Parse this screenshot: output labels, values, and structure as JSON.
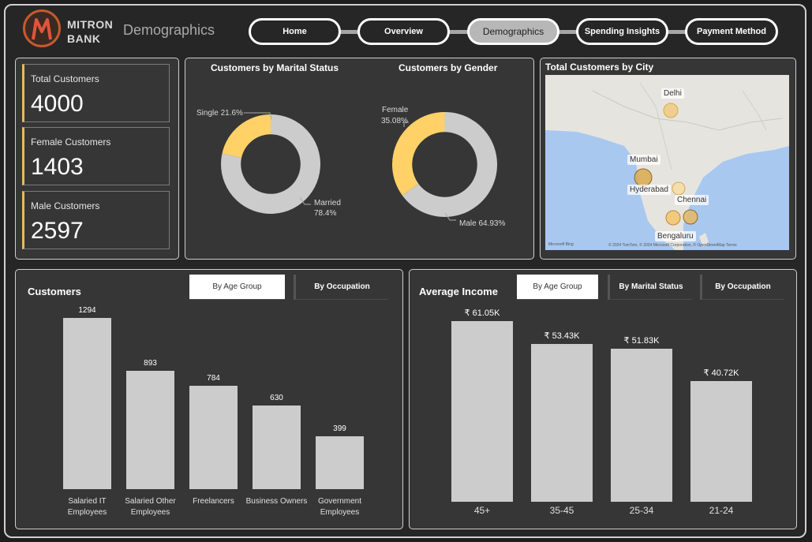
{
  "brand": {
    "line1": "MITRON",
    "line2": "BANK",
    "logo_letter": "M"
  },
  "page_title": "Demographics",
  "nav": [
    {
      "label": "Home",
      "active": false
    },
    {
      "label": "Overview",
      "active": false
    },
    {
      "label": "Demographics",
      "active": true
    },
    {
      "label": "Spending Insights",
      "active": false
    },
    {
      "label": "Payment Method",
      "active": false
    }
  ],
  "kpis": [
    {
      "label": "Total Customers",
      "value": "4000"
    },
    {
      "label": "Female Customers",
      "value": "1403"
    },
    {
      "label": "Male Customers",
      "value": "2597"
    }
  ],
  "marital": {
    "title": "Customers by Marital Status",
    "single_label": "Single 21.6%",
    "married_label": "Married",
    "married_pct": "78.4%"
  },
  "gender": {
    "title": "Customers by Gender",
    "female_label": "Female",
    "female_pct": "35.08%",
    "male_label": "Male 64.93%"
  },
  "city": {
    "title": "Total Customers by City",
    "cities": [
      "Delhi",
      "Mumbai",
      "Hyderabad",
      "Chennai",
      "Bengaluru"
    ],
    "foot_brand": "Microsoft Bing",
    "foot_copy": "© 2024 TomTom, © 2024 Microsoft Corporation, © OpenStreetMap  Terms"
  },
  "customers_panel": {
    "title": "Customers",
    "tabs": [
      "By Age Group",
      "By Occupation"
    ]
  },
  "income_panel": {
    "title": "Average Income",
    "tabs": [
      "By Age Group",
      "By Marital Status",
      "By Occupation"
    ]
  },
  "colors": {
    "accent": "#ffd166",
    "bar": "#cccccc",
    "panel": "#363636",
    "frame": "#262626"
  },
  "chart_data": [
    {
      "type": "pie",
      "title": "Customers by Marital Status",
      "categories": [
        "Single",
        "Married"
      ],
      "values": [
        21.6,
        78.4
      ],
      "colors": [
        "#ffd166",
        "#cccccc"
      ]
    },
    {
      "type": "pie",
      "title": "Customers by Gender",
      "categories": [
        "Female",
        "Male"
      ],
      "values": [
        35.08,
        64.93
      ],
      "colors": [
        "#ffd166",
        "#cccccc"
      ]
    },
    {
      "type": "bar",
      "title": "Customers",
      "categories": [
        "Salaried IT Employees",
        "Salaried Other Employees",
        "Freelancers",
        "Business Owners",
        "Government Employees"
      ],
      "values": [
        1294,
        893,
        784,
        630,
        399
      ],
      "labels": [
        "1294",
        "893",
        "784",
        "630",
        "399"
      ]
    },
    {
      "type": "bar",
      "title": "Average Income",
      "categories": [
        "45+",
        "35-45",
        "25-34",
        "21-24"
      ],
      "values": [
        61050,
        53430,
        51830,
        40720
      ],
      "labels": [
        "₹ 61.05K",
        "₹ 53.43K",
        "₹ 51.83K",
        "₹ 40.72K"
      ]
    }
  ]
}
